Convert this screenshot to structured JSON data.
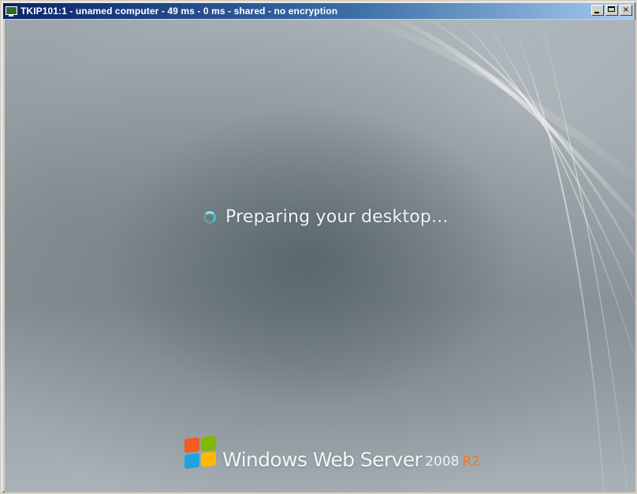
{
  "window": {
    "title": "TKIP101:1 - unamed computer - 49 ms - 0 ms - shared - no encryption",
    "icon": "vnc-viewer-icon",
    "buttons": {
      "minimize": "minimize-icon",
      "maximize": "maximize-icon",
      "close": "×"
    }
  },
  "screen": {
    "status_text": "Preparing your desktop...",
    "spinner_icon": "busy-spinner-icon",
    "brand": {
      "logo": "windows-flag-icon",
      "name": "Windows Web Server",
      "version": "2008",
      "edition": "R2"
    },
    "colors": {
      "accent_spinner": "#7fe8ee",
      "edition_color": "#f0772d",
      "titlebar_start": "#0a246a",
      "titlebar_end": "#a6caf0"
    }
  }
}
